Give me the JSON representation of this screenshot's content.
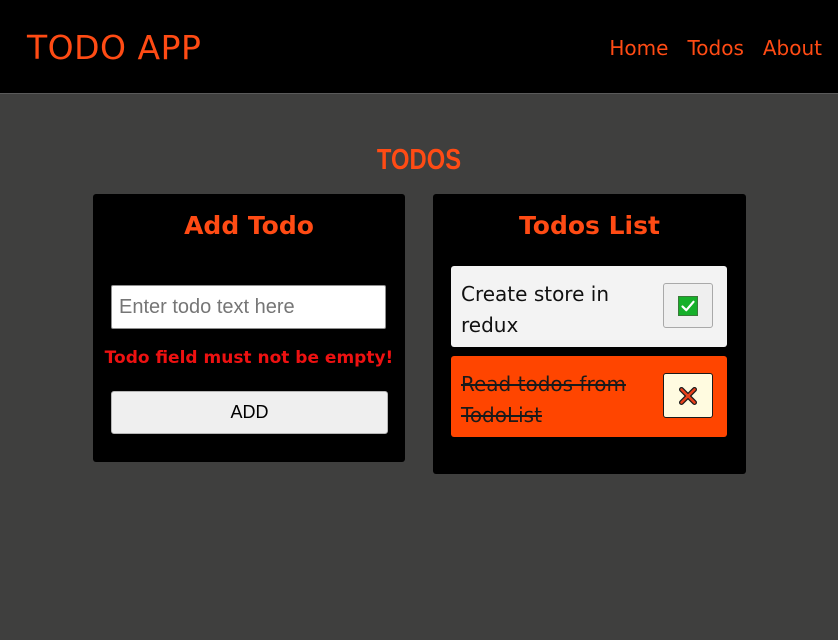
{
  "header": {
    "brand": "TODO APP",
    "nav": [
      "Home",
      "Todos",
      "About"
    ]
  },
  "main": {
    "title": "TODOS"
  },
  "add_todo": {
    "title": "Add Todo",
    "input_placeholder": "Enter todo text here",
    "input_value": "",
    "error": "Todo field must not be empty!",
    "add_label": "ADD"
  },
  "todos_list": {
    "title": "Todos List",
    "items": [
      {
        "text": "Create store in redux",
        "completed": false,
        "toggle_icon": "check-mark-icon"
      },
      {
        "text": "Read todos from TodoList",
        "completed": true,
        "toggle_icon": "cross-mark-icon"
      }
    ]
  },
  "colors": {
    "accent": "#ff4b14",
    "completed_bg": "#ff4500",
    "error": "#ee1111",
    "page_bg": "#3f3f3e",
    "panel_bg": "#000000"
  }
}
